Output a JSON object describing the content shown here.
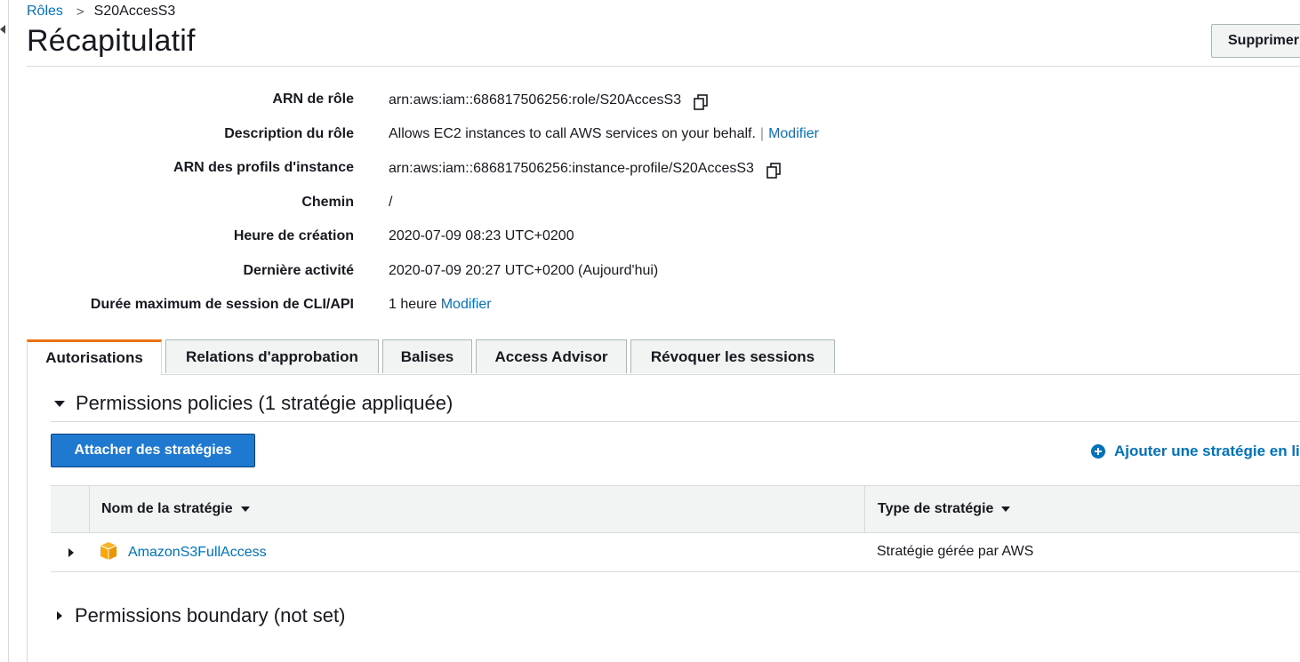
{
  "breadcrumb": {
    "parent": "Rôles",
    "separator": ">",
    "current": "S20AccesS3"
  },
  "page": {
    "title": "Récapitulatif",
    "delete_label": "Supprimer le rôle"
  },
  "summary": {
    "rows": [
      {
        "label": "ARN de rôle",
        "value": "arn:aws:iam::686817506256:role/S20AccesS3",
        "copy": true
      },
      {
        "label": "Description du rôle",
        "value": "Allows EC2 instances to call AWS services on your behalf.",
        "pipe": "|",
        "link": "Modifier"
      },
      {
        "label": "ARN des profils d'instance",
        "value": "arn:aws:iam::686817506256:instance-profile/S20AccesS3",
        "copy": true
      },
      {
        "label": "Chemin",
        "value": "/"
      },
      {
        "label": "Heure de création",
        "value": "2020-07-09 08:23 UTC+0200"
      },
      {
        "label": "Dernière activité",
        "value": "2020-07-09 20:27 UTC+0200 (Aujourd'hui)"
      },
      {
        "label": "Durée maximum de session de CLI/API",
        "value": "1 heure",
        "link": "Modifier"
      }
    ]
  },
  "tabs": [
    {
      "label": "Autorisations",
      "active": true
    },
    {
      "label": "Relations d'approbation"
    },
    {
      "label": "Balises"
    },
    {
      "label": "Access Advisor"
    },
    {
      "label": "Révoquer les sessions"
    }
  ],
  "permissions": {
    "heading": "Permissions policies (1 stratégie appliquée)",
    "attach_label": "Attacher des stratégies",
    "add_inline_label": "Ajouter une stratégie en ligne",
    "table": {
      "columns": [
        "Nom de la stratégie",
        "Type de stratégie"
      ],
      "rows": [
        {
          "name": "AmazonS3FullAccess",
          "type": "Stratégie gérée par AWS",
          "icon": "aws-managed-policy-cube-icon"
        }
      ]
    }
  },
  "boundary": {
    "heading": "Permissions boundary (not set)"
  },
  "colors": {
    "link": "#0073bb",
    "accent": "#ec7211",
    "primary_button": "#1f79d1",
    "policy_icon": "#f7a80d"
  }
}
